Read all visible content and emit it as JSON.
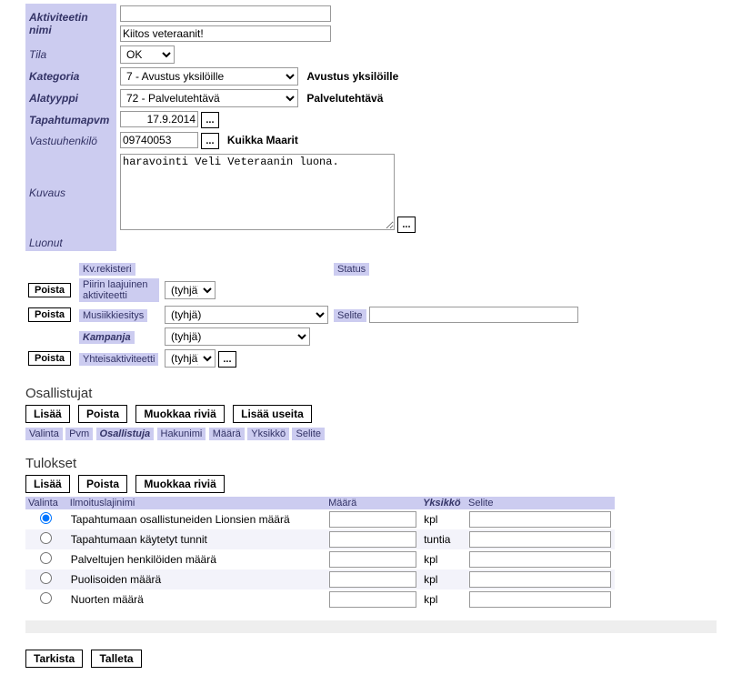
{
  "form": {
    "aktiviteetin_nimi_label": "Aktiviteetin nimi",
    "aktiviteetin_nimi": "Kiitos veteraanit!",
    "tila_label": "Tila",
    "tila": "OK",
    "kategoria_label": "Kategoria",
    "kategoria": "7 - Avustus yksilöille",
    "kategoria_text": "Avustus yksilöille",
    "alatyyppi_label": "Alatyyppi",
    "alatyyppi": "72 - Palvelutehtävä",
    "alatyyppi_text": "Palvelutehtävä",
    "tapahtumapvm_label": "Tapahtumapvm",
    "tapahtumapvm": "17.9.2014",
    "vastuuhenkilo_label": "Vastuuhenkilö",
    "vastuuhenkilo_code": "09740053",
    "vastuuhenkilo_name": "Kuikka Maarit",
    "kuvaus_label": "Kuvaus",
    "kuvaus": "haravointi Veli Veteraanin luona.",
    "luonut_label": "Luonut"
  },
  "sub": {
    "kv_rekisteri": "Kv.rekisteri",
    "status": "Status",
    "poista": "Poista",
    "piirin_laajuinen": "Piirin laajuinen aktiviteetti",
    "musiikkiesitys": "Musiikkiesitys",
    "selite": "Selite",
    "kampanja": "Kampanja",
    "yhteisaktiviteetti": "Yhteisaktiviteetti",
    "tyhja": "(tyhjä)"
  },
  "osallistujat": {
    "title": "Osallistujat",
    "lisaa": "Lisää",
    "poista": "Poista",
    "muokkaa": "Muokkaa riviä",
    "lisaa_useita": "Lisää useita",
    "cols": {
      "valinta": "Valinta",
      "pvm": "Pvm",
      "osallistuja": "Osallistuja",
      "hakunimi": "Hakunimi",
      "maara": "Määrä",
      "yksikko": "Yksikkö",
      "selite": "Selite"
    }
  },
  "tulokset": {
    "title": "Tulokset",
    "lisaa": "Lisää",
    "poista": "Poista",
    "muokkaa": "Muokkaa riviä",
    "cols": {
      "valinta": "Valinta",
      "ilmoituslajinimi": "Ilmoituslajinimi",
      "maara": "Määrä",
      "yksikko": "Yksikkö",
      "selite": "Selite"
    },
    "rows": [
      {
        "name": "Tapahtumaan osallistuneiden Lionsien määrä",
        "maara": "",
        "unit": "kpl",
        "selite": "",
        "checked": true
      },
      {
        "name": "Tapahtumaan käytetyt tunnit",
        "maara": "",
        "unit": "tuntia",
        "selite": "",
        "checked": false
      },
      {
        "name": "Palveltujen henkilöiden määrä",
        "maara": "",
        "unit": "kpl",
        "selite": "",
        "checked": false
      },
      {
        "name": "Puolisoiden määrä",
        "maara": "",
        "unit": "kpl",
        "selite": "",
        "checked": false
      },
      {
        "name": "Nuorten määrä",
        "maara": "",
        "unit": "kpl",
        "selite": "",
        "checked": false
      }
    ]
  },
  "footer": {
    "tarkista": "Tarkista",
    "talleta": "Talleta"
  }
}
